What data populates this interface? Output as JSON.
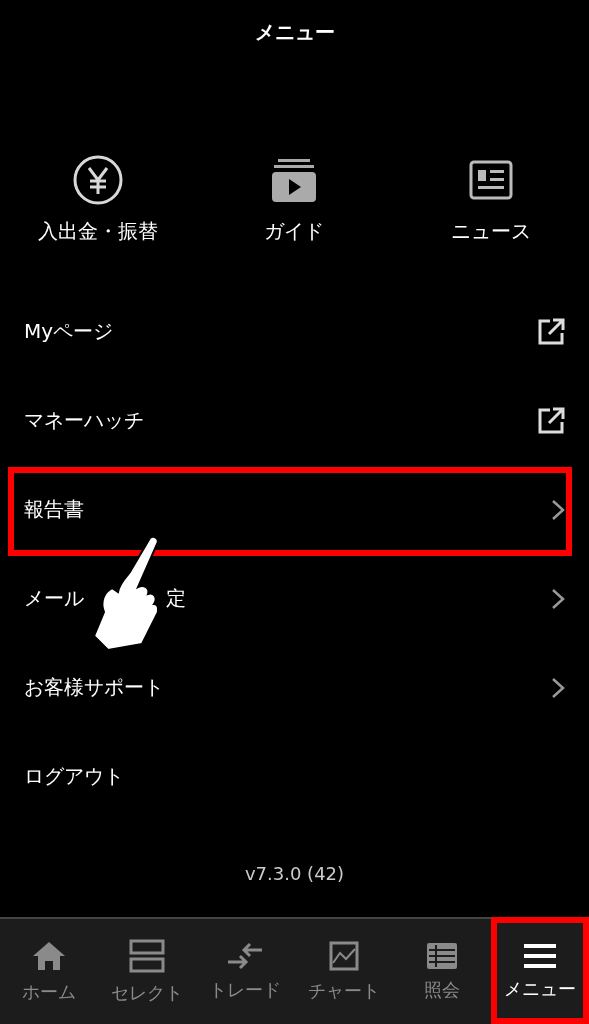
{
  "header": {
    "title": "メニュー"
  },
  "shortcuts": [
    {
      "label": "入出金・振替"
    },
    {
      "label": "ガイド"
    },
    {
      "label": "ニュース"
    }
  ],
  "items": [
    {
      "label": "Myページ",
      "kind": "external",
      "highlighted": false
    },
    {
      "label": "マネーハッチ",
      "kind": "external",
      "highlighted": false
    },
    {
      "label": "報告書",
      "kind": "link",
      "highlighted": true
    },
    {
      "label": "メール",
      "label_end": "定",
      "kind": "link",
      "highlighted": false
    },
    {
      "label": "お客様サポート",
      "kind": "link",
      "highlighted": false
    },
    {
      "label": "ログアウト",
      "kind": "plain",
      "highlighted": false
    }
  ],
  "version": "v7.3.0 (42)",
  "tab_bar": [
    {
      "label": "ホーム",
      "selected": false,
      "highlighted": false
    },
    {
      "label": "セレクト",
      "selected": false,
      "highlighted": false
    },
    {
      "label": "トレード",
      "selected": false,
      "highlighted": false
    },
    {
      "label": "チャート",
      "selected": false,
      "highlighted": false
    },
    {
      "label": "照会",
      "selected": false,
      "highlighted": false
    },
    {
      "label": "メニュー",
      "selected": true,
      "highlighted": true
    }
  ]
}
